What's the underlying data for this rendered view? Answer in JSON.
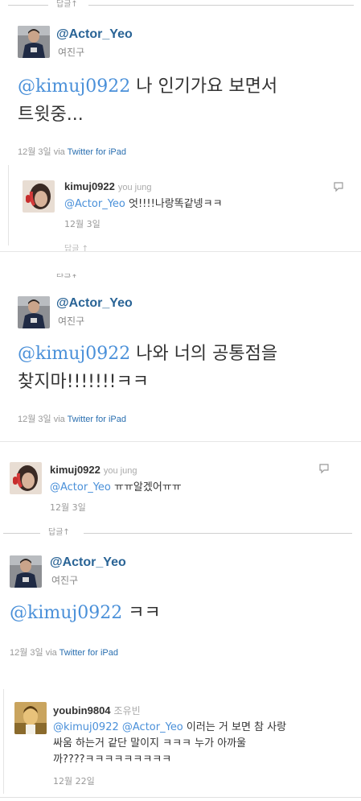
{
  "reply_label": "답글↑",
  "tweet1": {
    "handle": "@Actor_Yeo",
    "display_name": "여진구",
    "mention": "@kimuj0922",
    "text_line1": " 나 인기가요 보면서",
    "text_line2": "트윗중...",
    "date": "12월 3일",
    "via_label": "via",
    "via_client": "Twitter for iPad"
  },
  "reply1": {
    "username": "kimuj0922",
    "realname": "you jung",
    "mention": "@Actor_Yeo",
    "text": " 엇!!!!나랑똑같넹ㅋㅋ",
    "date": "12월 3일",
    "footer": "답글 ↑"
  },
  "tweet2": {
    "handle": "@Actor_Yeo",
    "display_name": "여진구",
    "mention": "@kimuj0922",
    "text_line1": " 나와 너의 공통점을",
    "text_line2": "찾지마!!!!!!!ㅋㅋ",
    "date": "12월 3일",
    "via_label": "via",
    "via_client": "Twitter for iPad"
  },
  "reply2": {
    "username": "kimuj0922",
    "realname": "you jung",
    "mention": "@Actor_Yeo",
    "text": " ㅠㅠ알겠어ㅠㅠ",
    "date": "12월 3일"
  },
  "tweet3": {
    "handle": "@Actor_Yeo",
    "display_name": "여진구",
    "mention": "@kimuj0922",
    "text_line1": " ㅋㅋ",
    "date": "12월 3일",
    "via_label": "via",
    "via_client": "Twitter for iPad"
  },
  "reply3": {
    "username": "youbin9804",
    "realname": "조유빈",
    "mention1": "@kimuj0922",
    "mention2": "@Actor_Yeo",
    "text_line1": " 이러는 거 보면 참 사랑",
    "text_line2": "싸움 하는거 같단 말이지 ㅋㅋㅋ 누가 아까울",
    "text_line3": "까????ㅋㅋㅋㅋㅋㅋㅋㅋㅋ",
    "date": "12월 22일"
  },
  "colors": {
    "link": "#2a6496",
    "mention": "#4a90d9",
    "meta": "#999999"
  },
  "icons": {
    "reply_bubble": "speech-bubble-icon",
    "avatar_actor": "avatar-actor-yeo",
    "avatar_kimuj": "avatar-kimuj0922",
    "avatar_youbin": "avatar-youbin9804"
  }
}
